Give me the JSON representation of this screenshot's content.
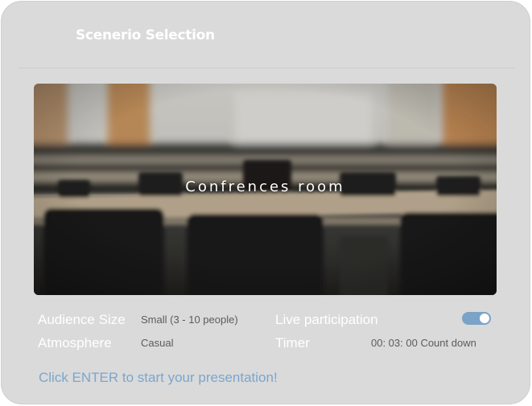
{
  "header": {
    "title": "Scenerio Selection"
  },
  "scene": {
    "label": "Confrences room",
    "image": "blurred-conference-room-photo"
  },
  "settings": {
    "audience_size": {
      "label": "Audience Size",
      "value": "Small (3 - 10 people)"
    },
    "atmosphere": {
      "label": "Atmosphere",
      "value": "Casual"
    },
    "live_participation": {
      "label": "Live participation",
      "enabled": true
    },
    "timer": {
      "label": "Timer",
      "value": "00: 03: 00 Count down"
    }
  },
  "footer": {
    "prompt": "Click ENTER to start your presentation!"
  },
  "colors": {
    "panel_bg": "#dadada",
    "accent": "#7aa6cf",
    "toggle_on": "#7aa3c8",
    "text_light": "#ffffff",
    "text_muted": "#5c5c5c"
  }
}
